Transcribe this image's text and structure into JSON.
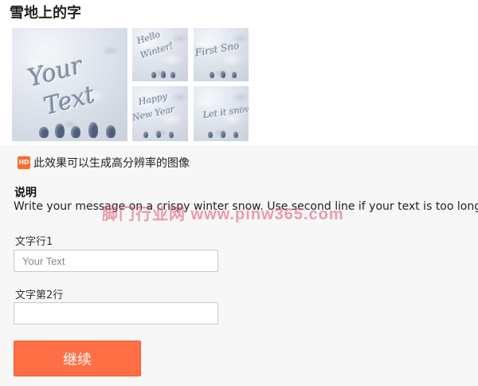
{
  "page": {
    "title": "雪地上的字"
  },
  "gallery": {
    "main": {
      "text": "Your Text"
    },
    "thumbs": [
      {
        "text": "Hello Winter!"
      },
      {
        "text": "First Snow"
      },
      {
        "text": "Happy New Year"
      },
      {
        "text": "Let it snow"
      }
    ]
  },
  "hd_note": {
    "badge": "HD",
    "text": "此效果可以生成高分辨率的图像"
  },
  "description": {
    "heading": "说明",
    "text": "Write your message on a crispy winter snow. Use second line if your text is too long."
  },
  "watermark": "脚门行业网 www.pinw365.com",
  "form": {
    "line1": {
      "label": "文字行1",
      "placeholder": "Your Text",
      "value": ""
    },
    "line2": {
      "label": "文字第2行",
      "placeholder": "",
      "value": ""
    },
    "continue_label": "继续"
  },
  "colors": {
    "accent": "#ff6f45",
    "hd_badge": "#ff6a2c"
  }
}
